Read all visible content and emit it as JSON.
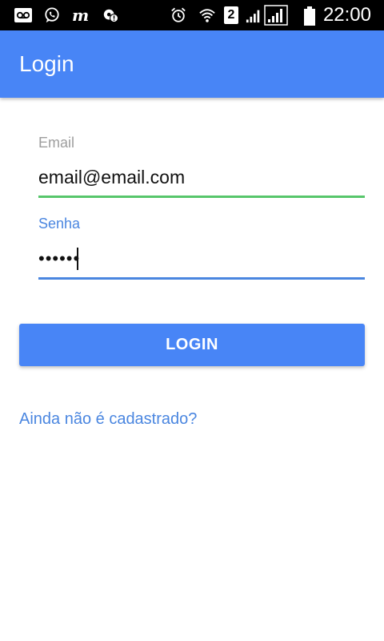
{
  "status_bar": {
    "time": "22:00",
    "sim_label": "2",
    "icons": [
      "voicemail-icon",
      "whatsapp-icon",
      "m-app-icon",
      "settings-alert-icon",
      "alarm-icon",
      "wifi-icon",
      "sim-icon",
      "signal-icon",
      "signal-icon",
      "battery-icon"
    ]
  },
  "app_bar": {
    "title": "Login",
    "color": "#4885f6"
  },
  "form": {
    "email": {
      "label": "Email",
      "value": "email@email.com",
      "underline_color": "#57c66b"
    },
    "password": {
      "label": "Senha",
      "value": "••••••",
      "underline_color": "#4a86e0"
    },
    "login_button": {
      "label": "LOGIN",
      "color": "#4885f6"
    },
    "signup_link": {
      "label": "Ainda não é cadastrado?",
      "color": "#4a86e0"
    }
  }
}
